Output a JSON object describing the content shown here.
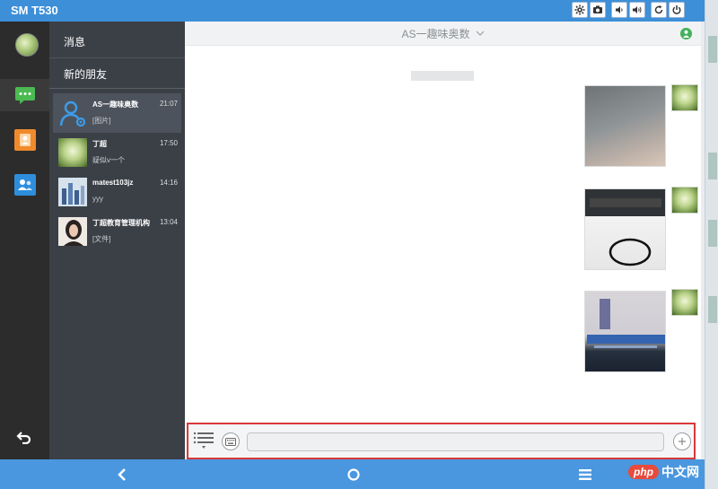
{
  "window": {
    "title": "SM T530"
  },
  "title_controls": [
    "gear-icon",
    "camera-icon",
    "volume-down-icon",
    "volume-up-icon",
    "rotate-icon",
    "power-icon"
  ],
  "sidebar": {
    "messages_label": "消息",
    "new_friends_label": "新的朋友"
  },
  "conversations": [
    {
      "name": "AS一趣味奥数",
      "preview": "[图片]",
      "time": "21:07",
      "avatar": "group-user-icon",
      "active": true
    },
    {
      "name": "丁超",
      "preview": "疑似v一个",
      "time": "17:50",
      "avatar": "flower-avatar"
    },
    {
      "name": "matest103jz",
      "preview": "yyy",
      "time": "14:16",
      "avatar": "building-avatar"
    },
    {
      "name": "丁超教育管理机构",
      "preview": "[文件]",
      "time": "13:04",
      "avatar": "person-avatar"
    }
  ],
  "chat": {
    "title": "AS一趣味奥数",
    "status_color": "#43b05c",
    "messages": [
      {
        "type": "image",
        "content": "gray-photo"
      },
      {
        "type": "image",
        "content": "cable-photo"
      },
      {
        "type": "image",
        "content": "screen-photo"
      }
    ]
  },
  "composer": {
    "placeholder": ""
  },
  "colors": {
    "accent": "#3d8fd8",
    "nav": "#4a97df",
    "highlight": "#d9383a"
  },
  "watermark": {
    "brand": "php",
    "text": "中文网"
  }
}
